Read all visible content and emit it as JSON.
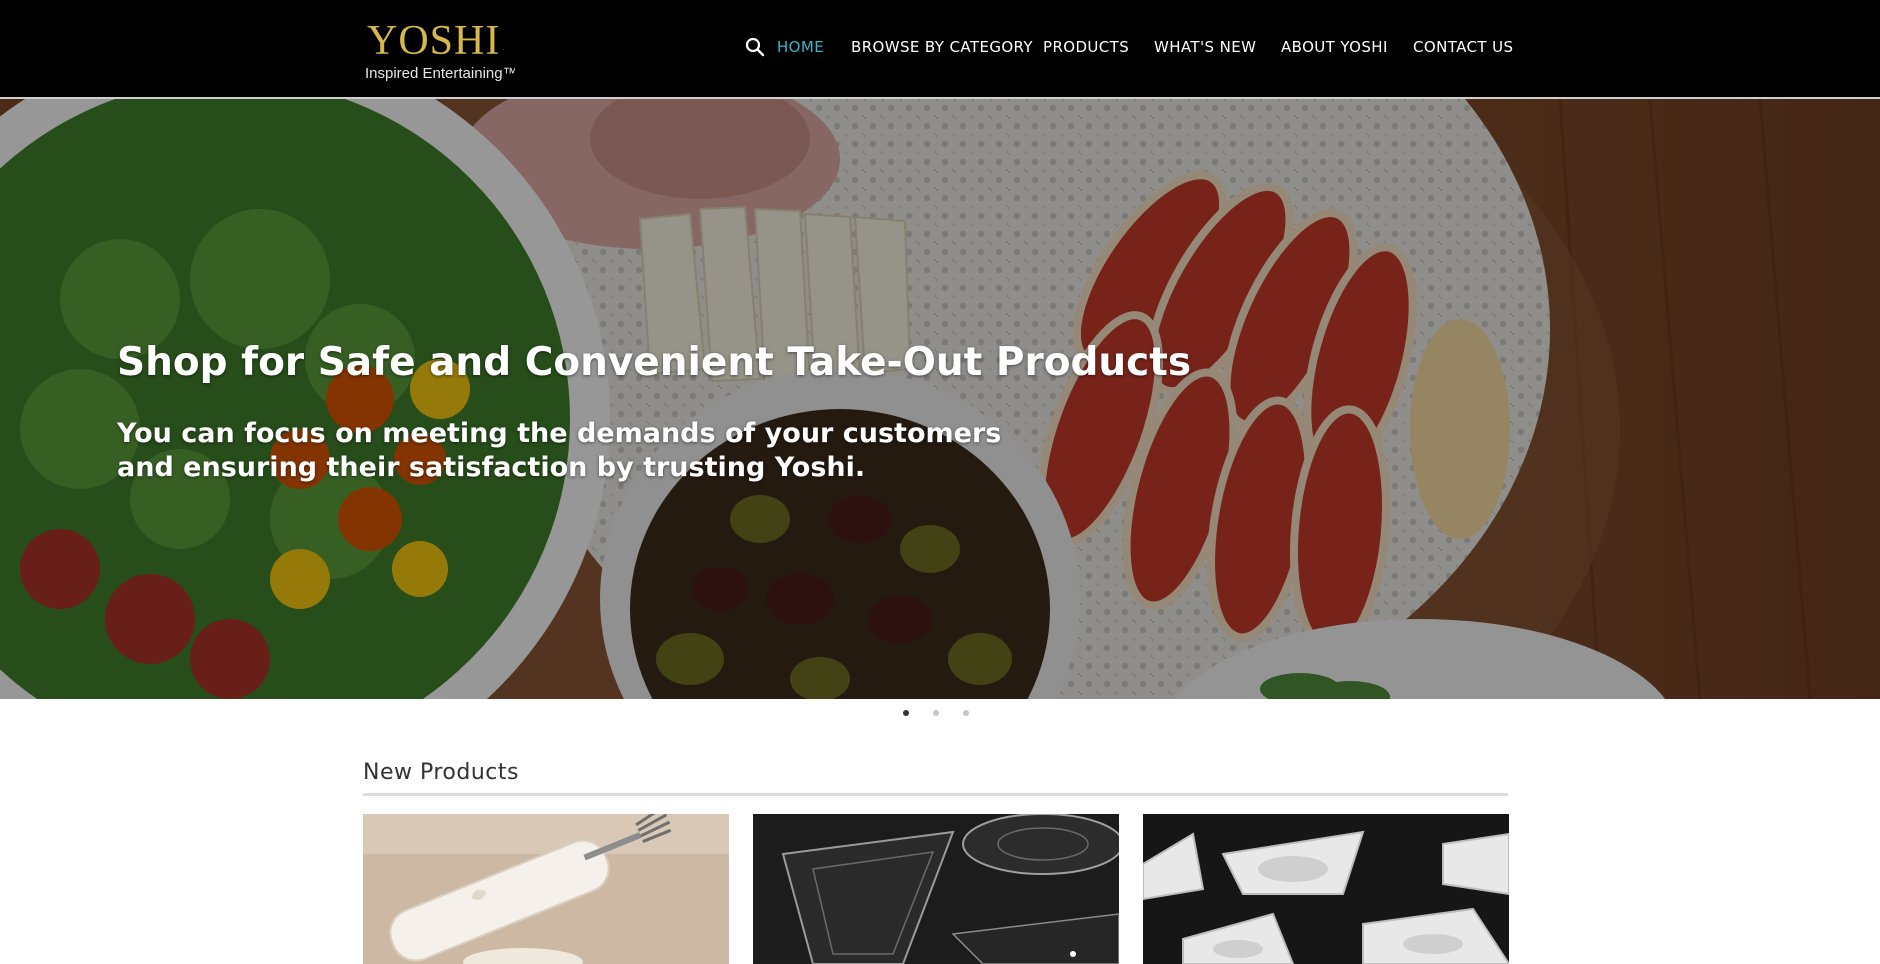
{
  "logo": {
    "name": "YOSHI",
    "tagline": "Inspired Entertaining™"
  },
  "nav": {
    "search_icon": "search-icon",
    "items": [
      {
        "label": "HOME",
        "active": true
      },
      {
        "label": "BROWSE BY CATEGORY",
        "active": false
      },
      {
        "label": "PRODUCTS",
        "active": false
      },
      {
        "label": "WHAT'S NEW",
        "active": false
      },
      {
        "label": "ABOUT YOSHI",
        "active": false
      },
      {
        "label": "CONTACT US",
        "active": false
      }
    ]
  },
  "hero": {
    "title": "Shop for Safe and Convenient Take-Out Products",
    "subtitle": "You can focus on meeting the demands of your customers and ensuring their satisfaction by trusting Yoshi."
  },
  "carousel": {
    "slide_count": 3,
    "active_index": 0
  },
  "new_products": {
    "title": "New Products",
    "items": [
      {
        "image": "napkin-with-fork-photo"
      },
      {
        "image": "clear-triangle-plates-photo"
      },
      {
        "image": "white-triangle-dishes-photo"
      }
    ]
  },
  "colors": {
    "header_bg": "#000000",
    "nav_active": "#3bb6cc",
    "nav_text": "#ffffff",
    "logo_gold": "#d9b84a",
    "dot_active": "#333333",
    "dot_inactive": "#c4c4c4"
  }
}
